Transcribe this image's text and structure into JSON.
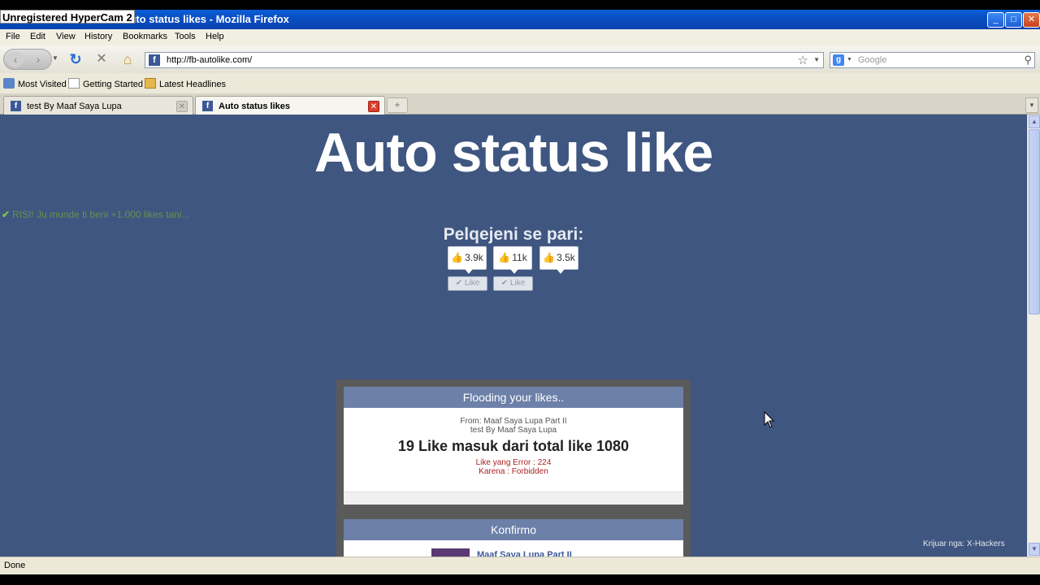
{
  "watermark": "Unregistered HyperCam 2",
  "window": {
    "title": "Auto status likes - Mozilla Firefox",
    "min": "_",
    "max": "□",
    "close": "✕"
  },
  "menu": [
    "File",
    "Edit",
    "View",
    "History",
    "Bookmarks",
    "Tools",
    "Help"
  ],
  "nav": {
    "back_icon": "‹",
    "forward_icon": "›",
    "reload_icon": "↻",
    "stop_icon": "✕",
    "home_icon": "⌂",
    "url": "http://fb-autolike.com/",
    "search_placeholder": "Google"
  },
  "bookmarks": [
    "Most Visited",
    "Getting Started",
    "Latest Headlines"
  ],
  "tabs": [
    {
      "label": "test By Maaf Saya Lupa",
      "active": false
    },
    {
      "label": "Auto status likes",
      "active": true
    }
  ],
  "page": {
    "headline": "Auto status like",
    "tick_text": "RISI! Ju munde ti beni +1.000 likes tani...",
    "share_title": "Pelqejeni se pari:",
    "like_counts": [
      "3.9k",
      "11k",
      "3.5k"
    ],
    "like_label": "Like",
    "flood_panel": {
      "header": "Flooding your likes..",
      "from": "From: Maaf Saya Lupa Part II",
      "by": "test By Maaf Saya Lupa",
      "result": "19 Like masuk dari total like 1080",
      "error_count": "Like yang Error : 224",
      "reason": "Karena : Forbidden"
    },
    "confirm_panel": {
      "header": "Konfirmo",
      "item_title": "Maaf Saya Lupa Part II"
    },
    "credit": "Krijuar nga: X-Hackers"
  },
  "status": "Done",
  "colors": {
    "page_bg": "#3f5680",
    "titlebar": "#0a4fc4",
    "panel_header": "#6c80a8"
  }
}
